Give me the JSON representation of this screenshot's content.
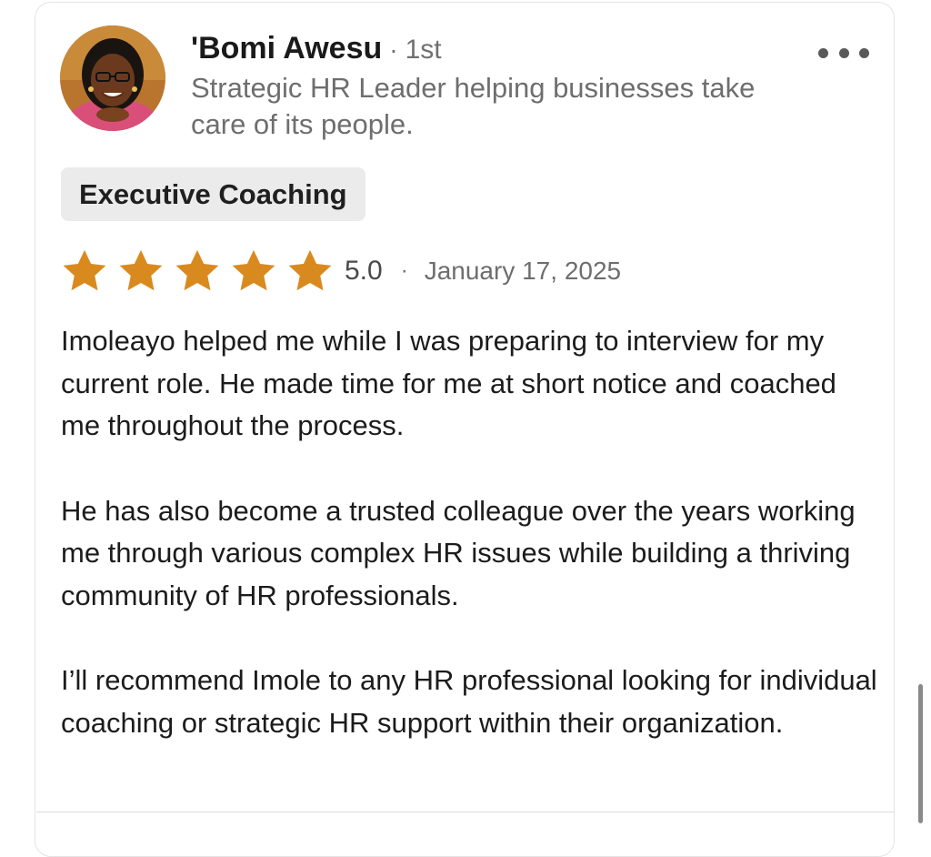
{
  "reviewer": {
    "name": "'Bomi Awesu",
    "separator": "·",
    "degree": "1st",
    "headline": "Strategic HR Leader helping businesses take care of its people.",
    "avatar_icon": "profile-photo"
  },
  "menu": {
    "icon": "more-horizontal-icon"
  },
  "service_tag": "Executive Coaching",
  "rating": {
    "value": "5.0",
    "stars_filled": 5,
    "stars_total": 5,
    "star_color": "#D98A1F",
    "separator": "·",
    "date": "January 17, 2025"
  },
  "review": {
    "paragraphs": [
      "Imoleayo helped me while I was preparing to interview for my current role. He made time for me at short notice and coached me throughout the process.",
      "He has also become a trusted colleague over the years working me through various complex HR issues while building a thriving community of HR professionals.",
      "I’ll recommend Imole to any HR professional looking for individual coaching or strategic HR support within their organization."
    ]
  }
}
